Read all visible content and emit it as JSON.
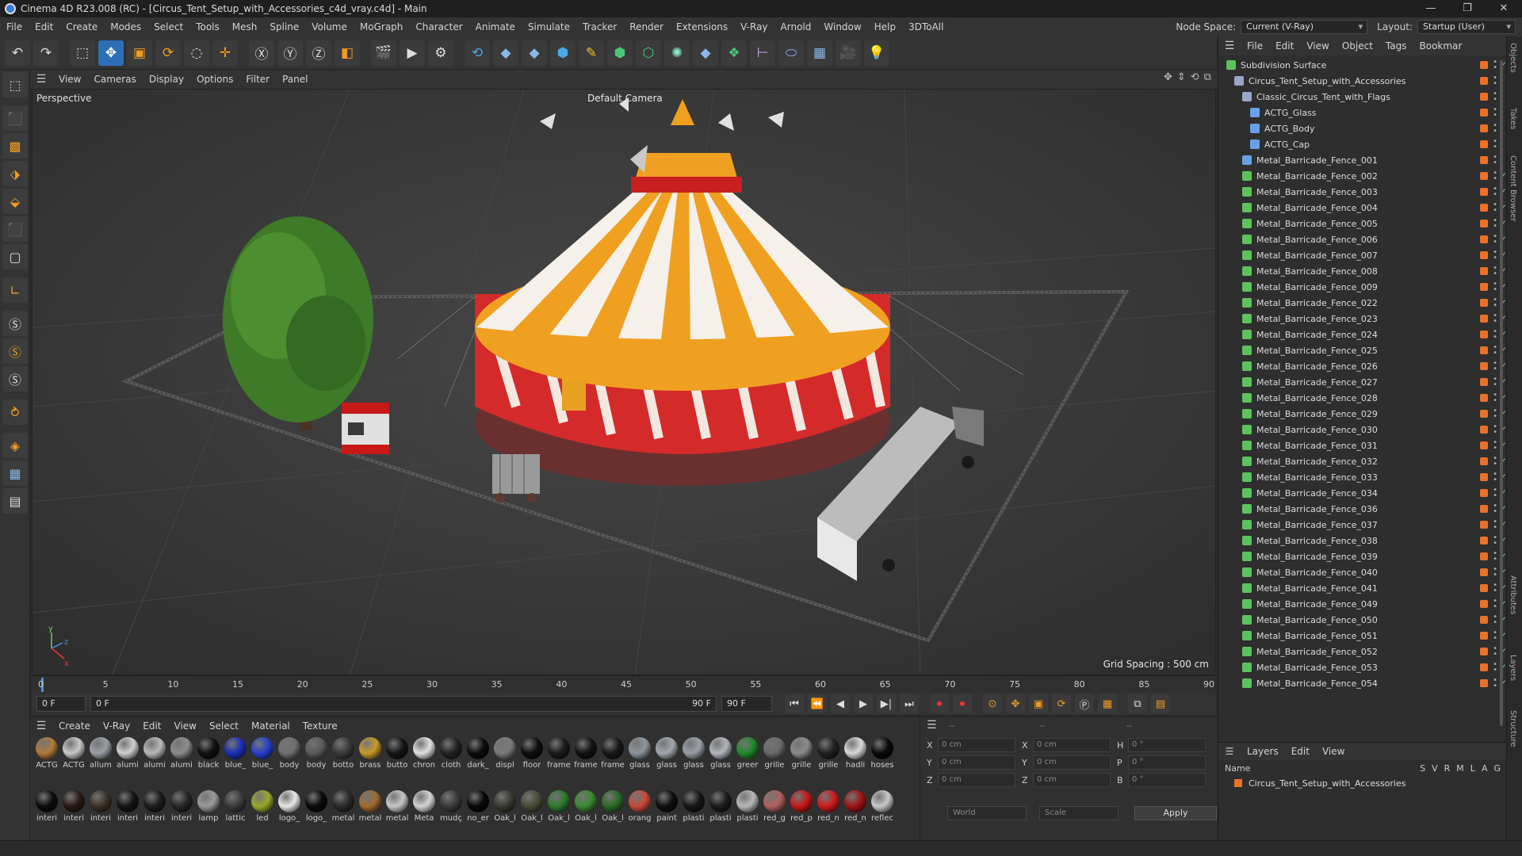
{
  "window": {
    "title": "Cinema 4D R23.008 (RC) - [Circus_Tent_Setup_with_Accessories_c4d_vray.c4d] - Main"
  },
  "menu": [
    "File",
    "Edit",
    "Create",
    "Modes",
    "Select",
    "Tools",
    "Mesh",
    "Spline",
    "Volume",
    "MoGraph",
    "Character",
    "Animate",
    "Simulate",
    "Tracker",
    "Render",
    "Extensions",
    "V-Ray",
    "Arnold",
    "Window",
    "Help",
    "3DToAll"
  ],
  "nodespace": {
    "label": "Node Space:",
    "value": "Current (V-Ray)"
  },
  "layout": {
    "label": "Layout:",
    "value": "Startup (User)"
  },
  "viewport_menu": [
    "View",
    "Cameras",
    "Display",
    "Options",
    "Filter",
    "Panel"
  ],
  "viewport": {
    "name": "Perspective",
    "camera": "Default Camera",
    "grid_spacing": "Grid Spacing : 500 cm"
  },
  "timeline": {
    "ticks": [
      "0",
      "5",
      "10",
      "15",
      "20",
      "25",
      "30",
      "35",
      "40",
      "45",
      "50",
      "55",
      "60",
      "65",
      "70",
      "75",
      "80",
      "85",
      "90"
    ],
    "current_frame": "0 F"
  },
  "transport": {
    "start": "0 F",
    "slider": "0 F",
    "end": "90 F",
    "end2": "90 F"
  },
  "materials_menu": [
    "Create",
    "V-Ray",
    "Edit",
    "View",
    "Select",
    "Material",
    "Texture"
  ],
  "materials": [
    {
      "n": "ACTG",
      "c": "#b07a3a"
    },
    {
      "n": "ACTG",
      "c": "#c8c8c8"
    },
    {
      "n": "allum",
      "c": "#9aa0a6"
    },
    {
      "n": "alumi",
      "c": "#d0d0d0"
    },
    {
      "n": "alumi",
      "c": "#b8b8b8"
    },
    {
      "n": "alumi",
      "c": "#8c8c8c"
    },
    {
      "n": "black",
      "c": "#101010"
    },
    {
      "n": "blue_",
      "c": "#1c2fb8"
    },
    {
      "n": "blue_",
      "c": "#2640d0"
    },
    {
      "n": "body",
      "c": "#707070"
    },
    {
      "n": "body",
      "c": "#5a5a5a"
    },
    {
      "n": "botto",
      "c": "#3a3a3a"
    },
    {
      "n": "brass",
      "c": "#c99a28"
    },
    {
      "n": "butto",
      "c": "#151515"
    },
    {
      "n": "chron",
      "c": "#e0e0e0"
    },
    {
      "n": "cloth",
      "c": "#222222"
    },
    {
      "n": "dark_",
      "c": "#0c0c0c"
    },
    {
      "n": "displ",
      "c": "#7a7a7a"
    },
    {
      "n": "floor",
      "c": "#0e0e0e"
    },
    {
      "n": "frame",
      "c": "#1a1a1a"
    },
    {
      "n": "frame",
      "c": "#121212"
    },
    {
      "n": "frame",
      "c": "#181818"
    },
    {
      "n": "glass",
      "c": "#8d949c"
    },
    {
      "n": "glass",
      "c": "#a3a9b0"
    },
    {
      "n": "glass",
      "c": "#9aa0a8"
    },
    {
      "n": "glass",
      "c": "#b2b7bd"
    },
    {
      "n": "greer",
      "c": "#1f8a2c"
    },
    {
      "n": "grille",
      "c": "#6a6a6a"
    },
    {
      "n": "grille",
      "c": "#8a8a8a"
    },
    {
      "n": "grille",
      "c": "#202020"
    },
    {
      "n": "hadli",
      "c": "#d8d8d8"
    },
    {
      "n": "hoses",
      "c": "#0a0a0a"
    },
    {
      "n": "interi",
      "c": "#0d0d0d"
    },
    {
      "n": "interi",
      "c": "#2a1a14"
    },
    {
      "n": "interi",
      "c": "#3a3228"
    },
    {
      "n": "interi",
      "c": "#141414"
    },
    {
      "n": "interi",
      "c": "#1c1c1c"
    },
    {
      "n": "interi",
      "c": "#262626"
    },
    {
      "n": "lamp",
      "c": "#9a9a9a"
    },
    {
      "n": "lattic",
      "c": "#3a3a3a"
    },
    {
      "n": "led",
      "c": "#9aa82a"
    },
    {
      "n": "logo_",
      "c": "#e8e8e8"
    },
    {
      "n": "logo_",
      "c": "#0a0a0a"
    },
    {
      "n": "metal",
      "c": "#2a2a2a"
    },
    {
      "n": "metal",
      "c": "#a06a30"
    },
    {
      "n": "metal",
      "c": "#c8c8c8"
    },
    {
      "n": "Meta",
      "c": "#d4d4d4"
    },
    {
      "n": "mudç",
      "c": "#3a3a3a"
    },
    {
      "n": "no_er",
      "c": "#080808"
    },
    {
      "n": "Oak_l",
      "c": "#3a3a30"
    },
    {
      "n": "Oak_l",
      "c": "#4a4a38"
    },
    {
      "n": "Oak_l",
      "c": "#2c7a2c"
    },
    {
      "n": "Oak_l",
      "c": "#3a8a30"
    },
    {
      "n": "Oak_l",
      "c": "#2a6a28"
    },
    {
      "n": "orang",
      "c": "#c84a3a"
    },
    {
      "n": "paint",
      "c": "#0e0e0e"
    },
    {
      "n": "plasti",
      "c": "#161616"
    },
    {
      "n": "plasti",
      "c": "#1c1c1c"
    },
    {
      "n": "plasti",
      "c": "#b8b8b8"
    },
    {
      "n": "red_g",
      "c": "#b06060"
    },
    {
      "n": "red_p",
      "c": "#c81818"
    },
    {
      "n": "red_n",
      "c": "#d01c1c"
    },
    {
      "n": "red_n",
      "c": "#a01414"
    },
    {
      "n": "reflec",
      "c": "#c8c8c8"
    }
  ],
  "coords": {
    "rows": [
      {
        "a": "X",
        "v1": "0 cm",
        "b": "X",
        "v2": "0 cm",
        "c": "H",
        "v3": "0 °"
      },
      {
        "a": "Y",
        "v1": "0 cm",
        "b": "Y",
        "v2": "0 cm",
        "c": "P",
        "v3": "0 °"
      },
      {
        "a": "Z",
        "v1": "0 cm",
        "b": "Z",
        "v2": "0 cm",
        "c": "B",
        "v3": "0 °"
      }
    ],
    "header": "--",
    "world": "World",
    "scale": "Scale",
    "apply": "Apply"
  },
  "objmenu": [
    "File",
    "Edit",
    "View",
    "Object",
    "Tags",
    "Bookmar"
  ],
  "objects": [
    {
      "name": "Subdivision Surface",
      "lvl": 0,
      "icon": "#5cc35c",
      "chk": true
    },
    {
      "name": "Circus_Tent_Setup_with_Accessories",
      "lvl": 1,
      "icon": "#9aa7c9",
      "chk": false
    },
    {
      "name": "Classic_Circus_Tent_with_Flags",
      "lvl": 2,
      "icon": "#9aa7c9",
      "chk": false
    },
    {
      "name": "ACTG_Glass",
      "lvl": 3,
      "icon": "#6aa0e8",
      "chk": false
    },
    {
      "name": "ACTG_Body",
      "lvl": 3,
      "icon": "#6aa0e8",
      "chk": false
    },
    {
      "name": "ACTG_Cap",
      "lvl": 3,
      "icon": "#6aa0e8",
      "chk": false
    },
    {
      "name": "Metal_Barricade_Fence_001",
      "lvl": 2,
      "icon": "#6aa0e8",
      "chk": false
    },
    {
      "name": "Metal_Barricade_Fence_002",
      "lvl": 2,
      "icon": "#5cc35c",
      "chk": true
    },
    {
      "name": "Metal_Barricade_Fence_003",
      "lvl": 2,
      "icon": "#5cc35c",
      "chk": true
    },
    {
      "name": "Metal_Barricade_Fence_004",
      "lvl": 2,
      "icon": "#5cc35c",
      "chk": true
    },
    {
      "name": "Metal_Barricade_Fence_005",
      "lvl": 2,
      "icon": "#5cc35c",
      "chk": true
    },
    {
      "name": "Metal_Barricade_Fence_006",
      "lvl": 2,
      "icon": "#5cc35c",
      "chk": true
    },
    {
      "name": "Metal_Barricade_Fence_007",
      "lvl": 2,
      "icon": "#5cc35c",
      "chk": true
    },
    {
      "name": "Metal_Barricade_Fence_008",
      "lvl": 2,
      "icon": "#5cc35c",
      "chk": true
    },
    {
      "name": "Metal_Barricade_Fence_009",
      "lvl": 2,
      "icon": "#5cc35c",
      "chk": true
    },
    {
      "name": "Metal_Barricade_Fence_022",
      "lvl": 2,
      "icon": "#5cc35c",
      "chk": true
    },
    {
      "name": "Metal_Barricade_Fence_023",
      "lvl": 2,
      "icon": "#5cc35c",
      "chk": true
    },
    {
      "name": "Metal_Barricade_Fence_024",
      "lvl": 2,
      "icon": "#5cc35c",
      "chk": true
    },
    {
      "name": "Metal_Barricade_Fence_025",
      "lvl": 2,
      "icon": "#5cc35c",
      "chk": true
    },
    {
      "name": "Metal_Barricade_Fence_026",
      "lvl": 2,
      "icon": "#5cc35c",
      "chk": true
    },
    {
      "name": "Metal_Barricade_Fence_027",
      "lvl": 2,
      "icon": "#5cc35c",
      "chk": true
    },
    {
      "name": "Metal_Barricade_Fence_028",
      "lvl": 2,
      "icon": "#5cc35c",
      "chk": true
    },
    {
      "name": "Metal_Barricade_Fence_029",
      "lvl": 2,
      "icon": "#5cc35c",
      "chk": true
    },
    {
      "name": "Metal_Barricade_Fence_030",
      "lvl": 2,
      "icon": "#5cc35c",
      "chk": true
    },
    {
      "name": "Metal_Barricade_Fence_031",
      "lvl": 2,
      "icon": "#5cc35c",
      "chk": true
    },
    {
      "name": "Metal_Barricade_Fence_032",
      "lvl": 2,
      "icon": "#5cc35c",
      "chk": true
    },
    {
      "name": "Metal_Barricade_Fence_033",
      "lvl": 2,
      "icon": "#5cc35c",
      "chk": true
    },
    {
      "name": "Metal_Barricade_Fence_034",
      "lvl": 2,
      "icon": "#5cc35c",
      "chk": true
    },
    {
      "name": "Metal_Barricade_Fence_036",
      "lvl": 2,
      "icon": "#5cc35c",
      "chk": true
    },
    {
      "name": "Metal_Barricade_Fence_037",
      "lvl": 2,
      "icon": "#5cc35c",
      "chk": true
    },
    {
      "name": "Metal_Barricade_Fence_038",
      "lvl": 2,
      "icon": "#5cc35c",
      "chk": true
    },
    {
      "name": "Metal_Barricade_Fence_039",
      "lvl": 2,
      "icon": "#5cc35c",
      "chk": true
    },
    {
      "name": "Metal_Barricade_Fence_040",
      "lvl": 2,
      "icon": "#5cc35c",
      "chk": true
    },
    {
      "name": "Metal_Barricade_Fence_041",
      "lvl": 2,
      "icon": "#5cc35c",
      "chk": true
    },
    {
      "name": "Metal_Barricade_Fence_049",
      "lvl": 2,
      "icon": "#5cc35c",
      "chk": true
    },
    {
      "name": "Metal_Barricade_Fence_050",
      "lvl": 2,
      "icon": "#5cc35c",
      "chk": true
    },
    {
      "name": "Metal_Barricade_Fence_051",
      "lvl": 2,
      "icon": "#5cc35c",
      "chk": true
    },
    {
      "name": "Metal_Barricade_Fence_052",
      "lvl": 2,
      "icon": "#5cc35c",
      "chk": true
    },
    {
      "name": "Metal_Barricade_Fence_053",
      "lvl": 2,
      "icon": "#5cc35c",
      "chk": true
    },
    {
      "name": "Metal_Barricade_Fence_054",
      "lvl": 2,
      "icon": "#5cc35c",
      "chk": true
    }
  ],
  "layers": {
    "menu": [
      "Layers",
      "Edit",
      "View"
    ],
    "header_name": "Name",
    "cols": [
      "S",
      "V",
      "R",
      "M",
      "L",
      "A",
      "G"
    ],
    "row": "Circus_Tent_Setup_with_Accessories"
  },
  "sidetabs": [
    "Objects",
    "Takes",
    "Content Browser",
    "Attributes",
    "Layers",
    "Structure"
  ],
  "colors": {
    "accent": "#2d6fb6",
    "tag": "#e8722b",
    "check": "#6ad16a"
  }
}
